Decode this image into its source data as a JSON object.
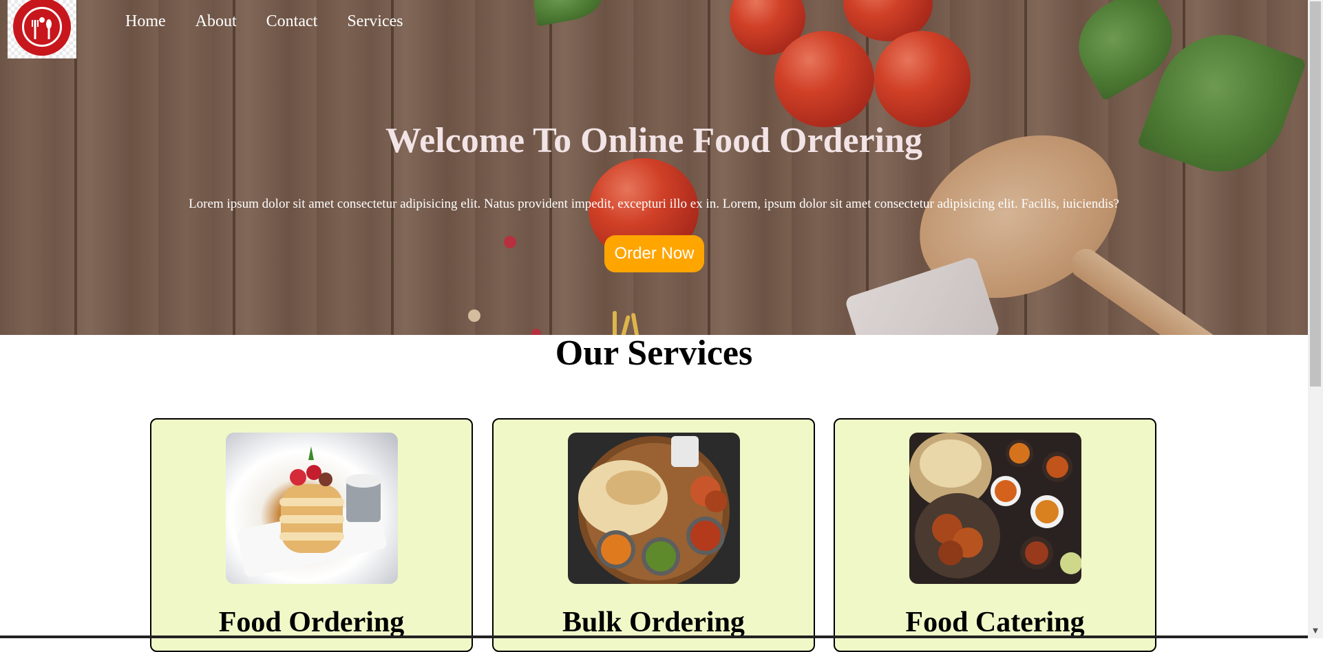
{
  "nav": {
    "logo_name": "restaurant-logo",
    "items": [
      "Home",
      "About",
      "Contact",
      "Services"
    ]
  },
  "hero": {
    "title": "Welcome To Online Food Ordering",
    "text": "Lorem ipsum dolor sit amet consectetur adipisicing elit. Natus provident impedit, excepturi illo ex in. Lorem, ipsum dolor sit amet consectetur adipisicing elit. Facilis, iuiciendis?",
    "button": "Order Now"
  },
  "services": {
    "title": "Our Services",
    "cards": [
      {
        "title": "Food Ordering"
      },
      {
        "title": "Bulk Ordering"
      },
      {
        "title": "Food Catering"
      }
    ]
  },
  "colors": {
    "accent_button": "#ffa500",
    "card_background": "#f1f8c8",
    "logo_red": "#c8161d"
  }
}
